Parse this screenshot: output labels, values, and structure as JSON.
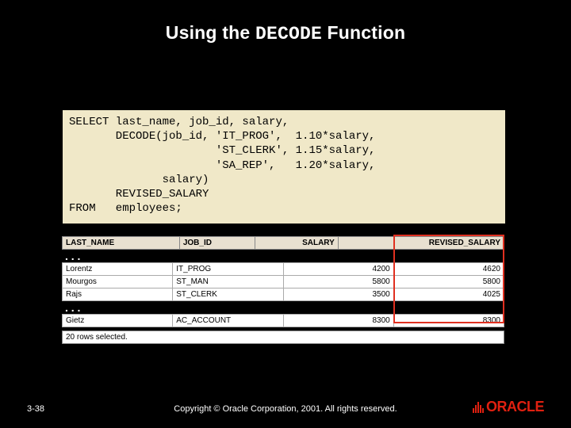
{
  "title_pre": "Using the ",
  "title_mono": "DECODE",
  "title_post": " Function",
  "code": "SELECT last_name, job_id, salary,\n       DECODE(job_id, 'IT_PROG',  1.10*salary,\n                      'ST_CLERK', 1.15*salary,\n                      'SA_REP',   1.20*salary,\n              salary)\n       REVISED_SALARY\nFROM   employees;",
  "columns": [
    "LAST_NAME",
    "JOB_ID",
    "SALARY",
    "REVISED_SALARY"
  ],
  "rows1": [
    {
      "c0": "Lorentz",
      "c1": "IT_PROG",
      "c2": "4200",
      "c3": "4620"
    },
    {
      "c0": "Mourgos",
      "c1": "ST_MAN",
      "c2": "5800",
      "c3": "5800"
    },
    {
      "c0": "Rajs",
      "c1": "ST_CLERK",
      "c2": "3500",
      "c3": "4025"
    }
  ],
  "rows2": [
    {
      "c0": "Gietz",
      "c1": "AC_ACCOUNT",
      "c2": "8300",
      "c3": "8300"
    }
  ],
  "ellipsis": ". . .",
  "status": "20 rows selected.",
  "pagenum": "3-38",
  "copyright": "Copyright © Oracle Corporation, 2001. All rights reserved.",
  "logo_text": "ORACLE"
}
